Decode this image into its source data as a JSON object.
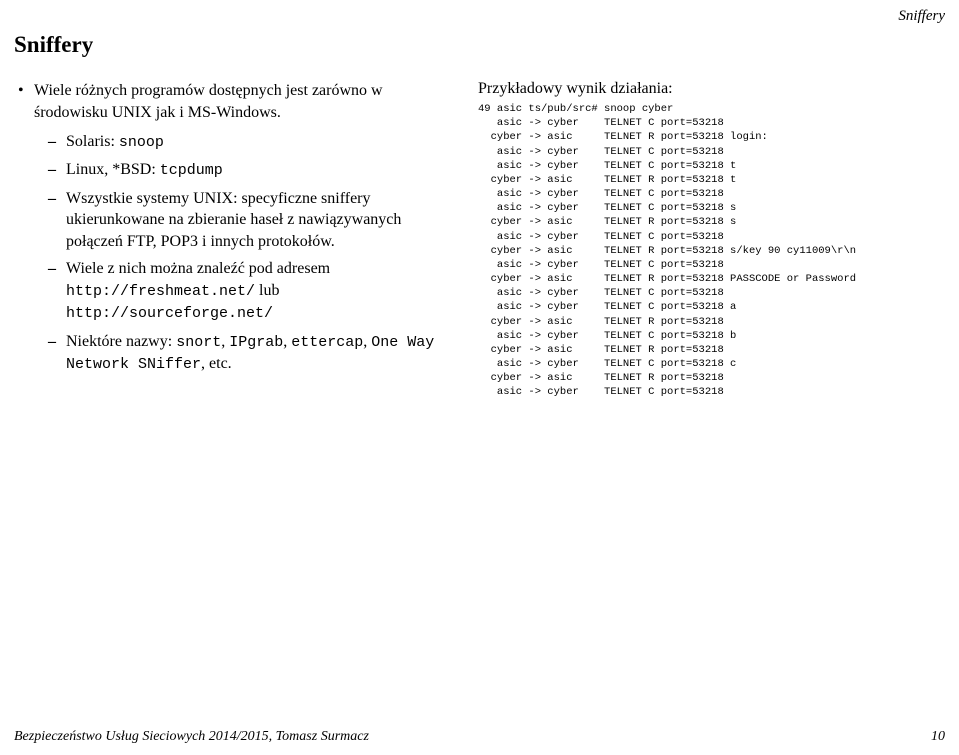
{
  "header": {
    "section": "Sniffery"
  },
  "title": "Sniffery",
  "left": {
    "top_bullet": "Wiele różnych programów dostępnych jest zarówno w środowisku UNIX jak i MS-Windows.",
    "items": [
      {
        "prefix": "Solaris: ",
        "mono": "snoop",
        "suffix": ""
      },
      {
        "prefix": "Linux, *BSD: ",
        "mono": "tcpdump",
        "suffix": ""
      },
      {
        "prefix": "Wszystkie systemy UNIX: specyficzne sniffery ukierunkowane na zbieranie haseł z nawiązywanych połączeń FTP, POP3 i innych protokołów.",
        "mono": "",
        "suffix": ""
      }
    ],
    "item4_pre": "Wiele z nich można znaleźć pod adresem ",
    "item4_m1": "http://freshmeat.net/",
    "item4_mid": " lub ",
    "item4_m2": "http://sourceforge.net/",
    "item5_pre": "Niektóre nazwy: ",
    "item5_m1": "snort",
    "item5_s1": ", ",
    "item5_m2": "IPgrab",
    "item5_s2": ", ",
    "item5_m3": "ettercap",
    "item5_s3": ", ",
    "item5_m4": "One Way Network SNiffer",
    "item5_s4": ", etc."
  },
  "right": {
    "para": "Przykładowy wynik działania:",
    "code": "49 asic ts/pub/src# snoop cyber\n   asic -> cyber    TELNET C port=53218\n  cyber -> asic     TELNET R port=53218 login:\n   asic -> cyber    TELNET C port=53218\n   asic -> cyber    TELNET C port=53218 t\n  cyber -> asic     TELNET R port=53218 t\n   asic -> cyber    TELNET C port=53218\n   asic -> cyber    TELNET C port=53218 s\n  cyber -> asic     TELNET R port=53218 s\n   asic -> cyber    TELNET C port=53218\n  cyber -> asic     TELNET R port=53218 s/key 90 cy11009\\r\\n\n   asic -> cyber    TELNET C port=53218\n  cyber -> asic     TELNET R port=53218 PASSCODE or Password\n   asic -> cyber    TELNET C port=53218\n   asic -> cyber    TELNET C port=53218 a\n  cyber -> asic     TELNET R port=53218\n   asic -> cyber    TELNET C port=53218 b\n  cyber -> asic     TELNET R port=53218\n   asic -> cyber    TELNET C port=53218 c\n  cyber -> asic     TELNET R port=53218\n   asic -> cyber    TELNET C port=53218"
  },
  "footer": {
    "left": "Bezpieczeństwo Usług Sieciowych 2014/2015, Tomasz Surmacz",
    "right": "10"
  }
}
